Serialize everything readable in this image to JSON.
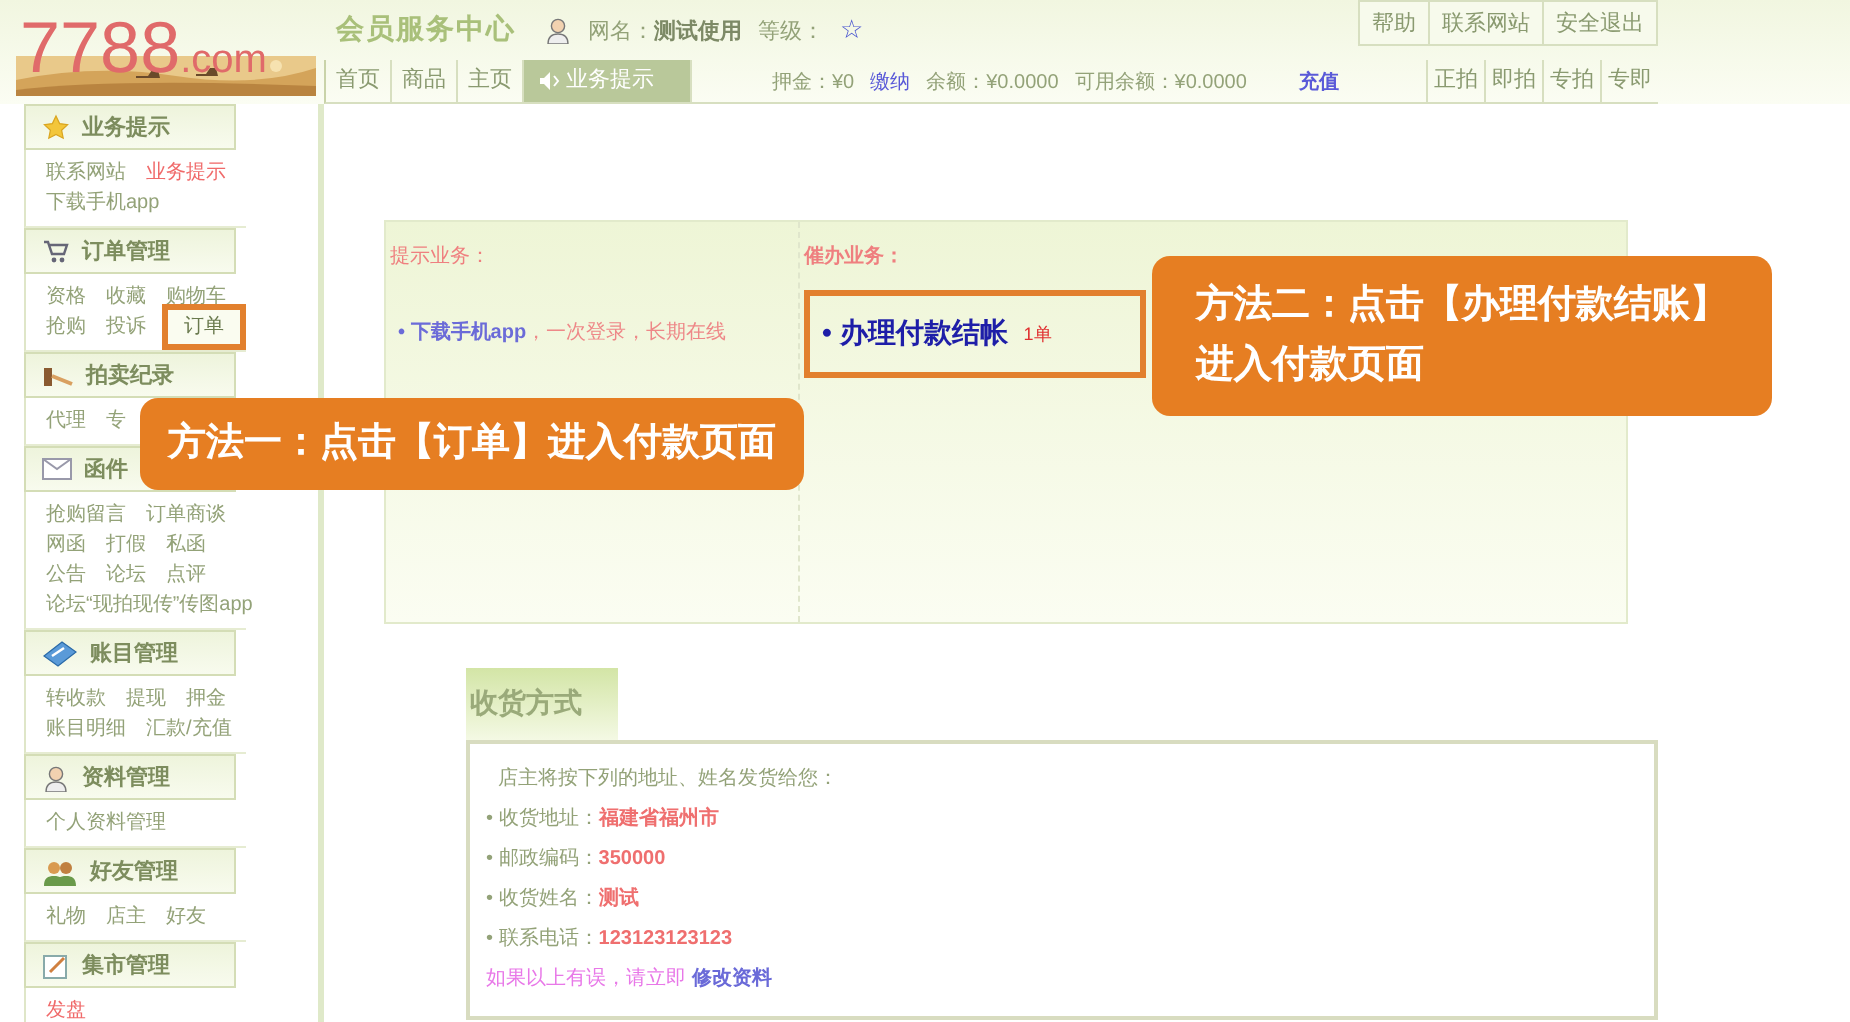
{
  "header": {
    "logo": {
      "number": "7788",
      "suffix": ".com"
    },
    "title": "会员服务中心",
    "user_label": "网名：",
    "user_name": "测试使用",
    "level_label": "等级：",
    "level_star": "☆",
    "top_links": [
      "帮助",
      "联系网站",
      "安全退出"
    ],
    "nav_tabs": [
      {
        "label": "首页",
        "selected": false
      },
      {
        "label": "商品",
        "selected": false
      },
      {
        "label": "主页",
        "selected": false
      },
      {
        "label": "业务提示",
        "selected": true
      }
    ],
    "account": [
      {
        "kind": "text",
        "text": "押金：¥0"
      },
      {
        "kind": "link",
        "text": "缴纳"
      },
      {
        "kind": "text",
        "text": "余额：¥0.0000"
      },
      {
        "kind": "text",
        "text": "可用余额：¥0.0000"
      },
      {
        "kind": "action",
        "text": "充值"
      }
    ],
    "mode_tabs": [
      "正拍",
      "即拍",
      "专拍",
      "专即"
    ]
  },
  "sidebar": {
    "sections": [
      {
        "title": "业务提示",
        "links": [
          {
            "label": "联系网站",
            "selected": false,
            "highlighted": false
          },
          {
            "label": "业务提示",
            "selected": true,
            "highlighted": false
          },
          {
            "label": "下载手机app",
            "selected": false,
            "highlighted": false
          }
        ]
      },
      {
        "title": "订单管理",
        "links": [
          {
            "label": "资格",
            "selected": false,
            "highlighted": false
          },
          {
            "label": "收藏",
            "selected": false,
            "highlighted": false
          },
          {
            "label": "购物车",
            "selected": false,
            "highlighted": false
          },
          {
            "label": "抢购",
            "selected": false,
            "highlighted": false
          },
          {
            "label": "投诉",
            "selected": false,
            "highlighted": false
          },
          {
            "label": "订单",
            "selected": false,
            "highlighted": true
          }
        ]
      },
      {
        "title": "拍卖纪录",
        "links": [
          {
            "label": "代理",
            "selected": false,
            "highlighted": false
          },
          {
            "label": "专",
            "selected": false,
            "highlighted": false
          }
        ]
      },
      {
        "title": "函件",
        "links": [
          {
            "label": "抢购留言",
            "selected": false,
            "highlighted": false
          },
          {
            "label": "订单商谈",
            "selected": false,
            "highlighted": false
          },
          {
            "label": "网函",
            "selected": false,
            "highlighted": false
          },
          {
            "label": "打假",
            "selected": false,
            "highlighted": false
          },
          {
            "label": "私函",
            "selected": false,
            "highlighted": false
          },
          {
            "label": "公告",
            "selected": false,
            "highlighted": false
          },
          {
            "label": "论坛",
            "selected": false,
            "highlighted": false
          },
          {
            "label": "点评",
            "selected": false,
            "highlighted": false
          },
          {
            "label": "论坛“现拍现传”传图app",
            "selected": false,
            "highlighted": false
          }
        ]
      },
      {
        "title": "账目管理",
        "links": [
          {
            "label": "转收款",
            "selected": false,
            "highlighted": false
          },
          {
            "label": "提现",
            "selected": false,
            "highlighted": false
          },
          {
            "label": "押金",
            "selected": false,
            "highlighted": false
          },
          {
            "label": "账目明细",
            "selected": false,
            "highlighted": false
          },
          {
            "label": "汇款/充值",
            "selected": false,
            "highlighted": false
          }
        ]
      },
      {
        "title": "资料管理",
        "links": [
          {
            "label": "个人资料管理",
            "selected": false,
            "highlighted": false
          }
        ]
      },
      {
        "title": "好友管理",
        "links": [
          {
            "label": "礼物",
            "selected": false,
            "highlighted": false
          },
          {
            "label": "店主",
            "selected": false,
            "highlighted": false
          },
          {
            "label": "好友",
            "selected": false,
            "highlighted": false
          }
        ]
      },
      {
        "title": "集市管理",
        "links": [
          {
            "label": "发盘",
            "selected": true,
            "highlighted": false
          }
        ]
      }
    ]
  },
  "tips": {
    "title": "提示业务：",
    "items": [
      {
        "bullet": "•",
        "link": "下载手机app",
        "text": "，一次登录，长期在线"
      }
    ]
  },
  "urgent": {
    "title": "催办业务：",
    "items": [
      {
        "bullet": "•",
        "label": "办理付款结帐",
        "count": "1单",
        "highlighted": true
      }
    ]
  },
  "shipping": {
    "title": "收货方式",
    "intro": "店主将按下列的地址、姓名发货给您：",
    "fields": [
      {
        "bullet": "•",
        "label": "收货地址：",
        "value": "福建省福州市"
      },
      {
        "bullet": "•",
        "label": "邮政编码：",
        "value": "350000"
      },
      {
        "bullet": "•",
        "label": "收货姓名：",
        "value": "测试"
      },
      {
        "bullet": "•",
        "label": "联系电话：",
        "value": "123123123123"
      }
    ],
    "note": "如果以上有误，请立即",
    "note_link": "修改资料"
  },
  "annotations": [
    {
      "lines": [
        "方法一：点击【订单】进入付款页面"
      ]
    },
    {
      "lines": [
        "方法二：点击【办理付款结账】",
        "进入付款页面"
      ]
    }
  ]
}
